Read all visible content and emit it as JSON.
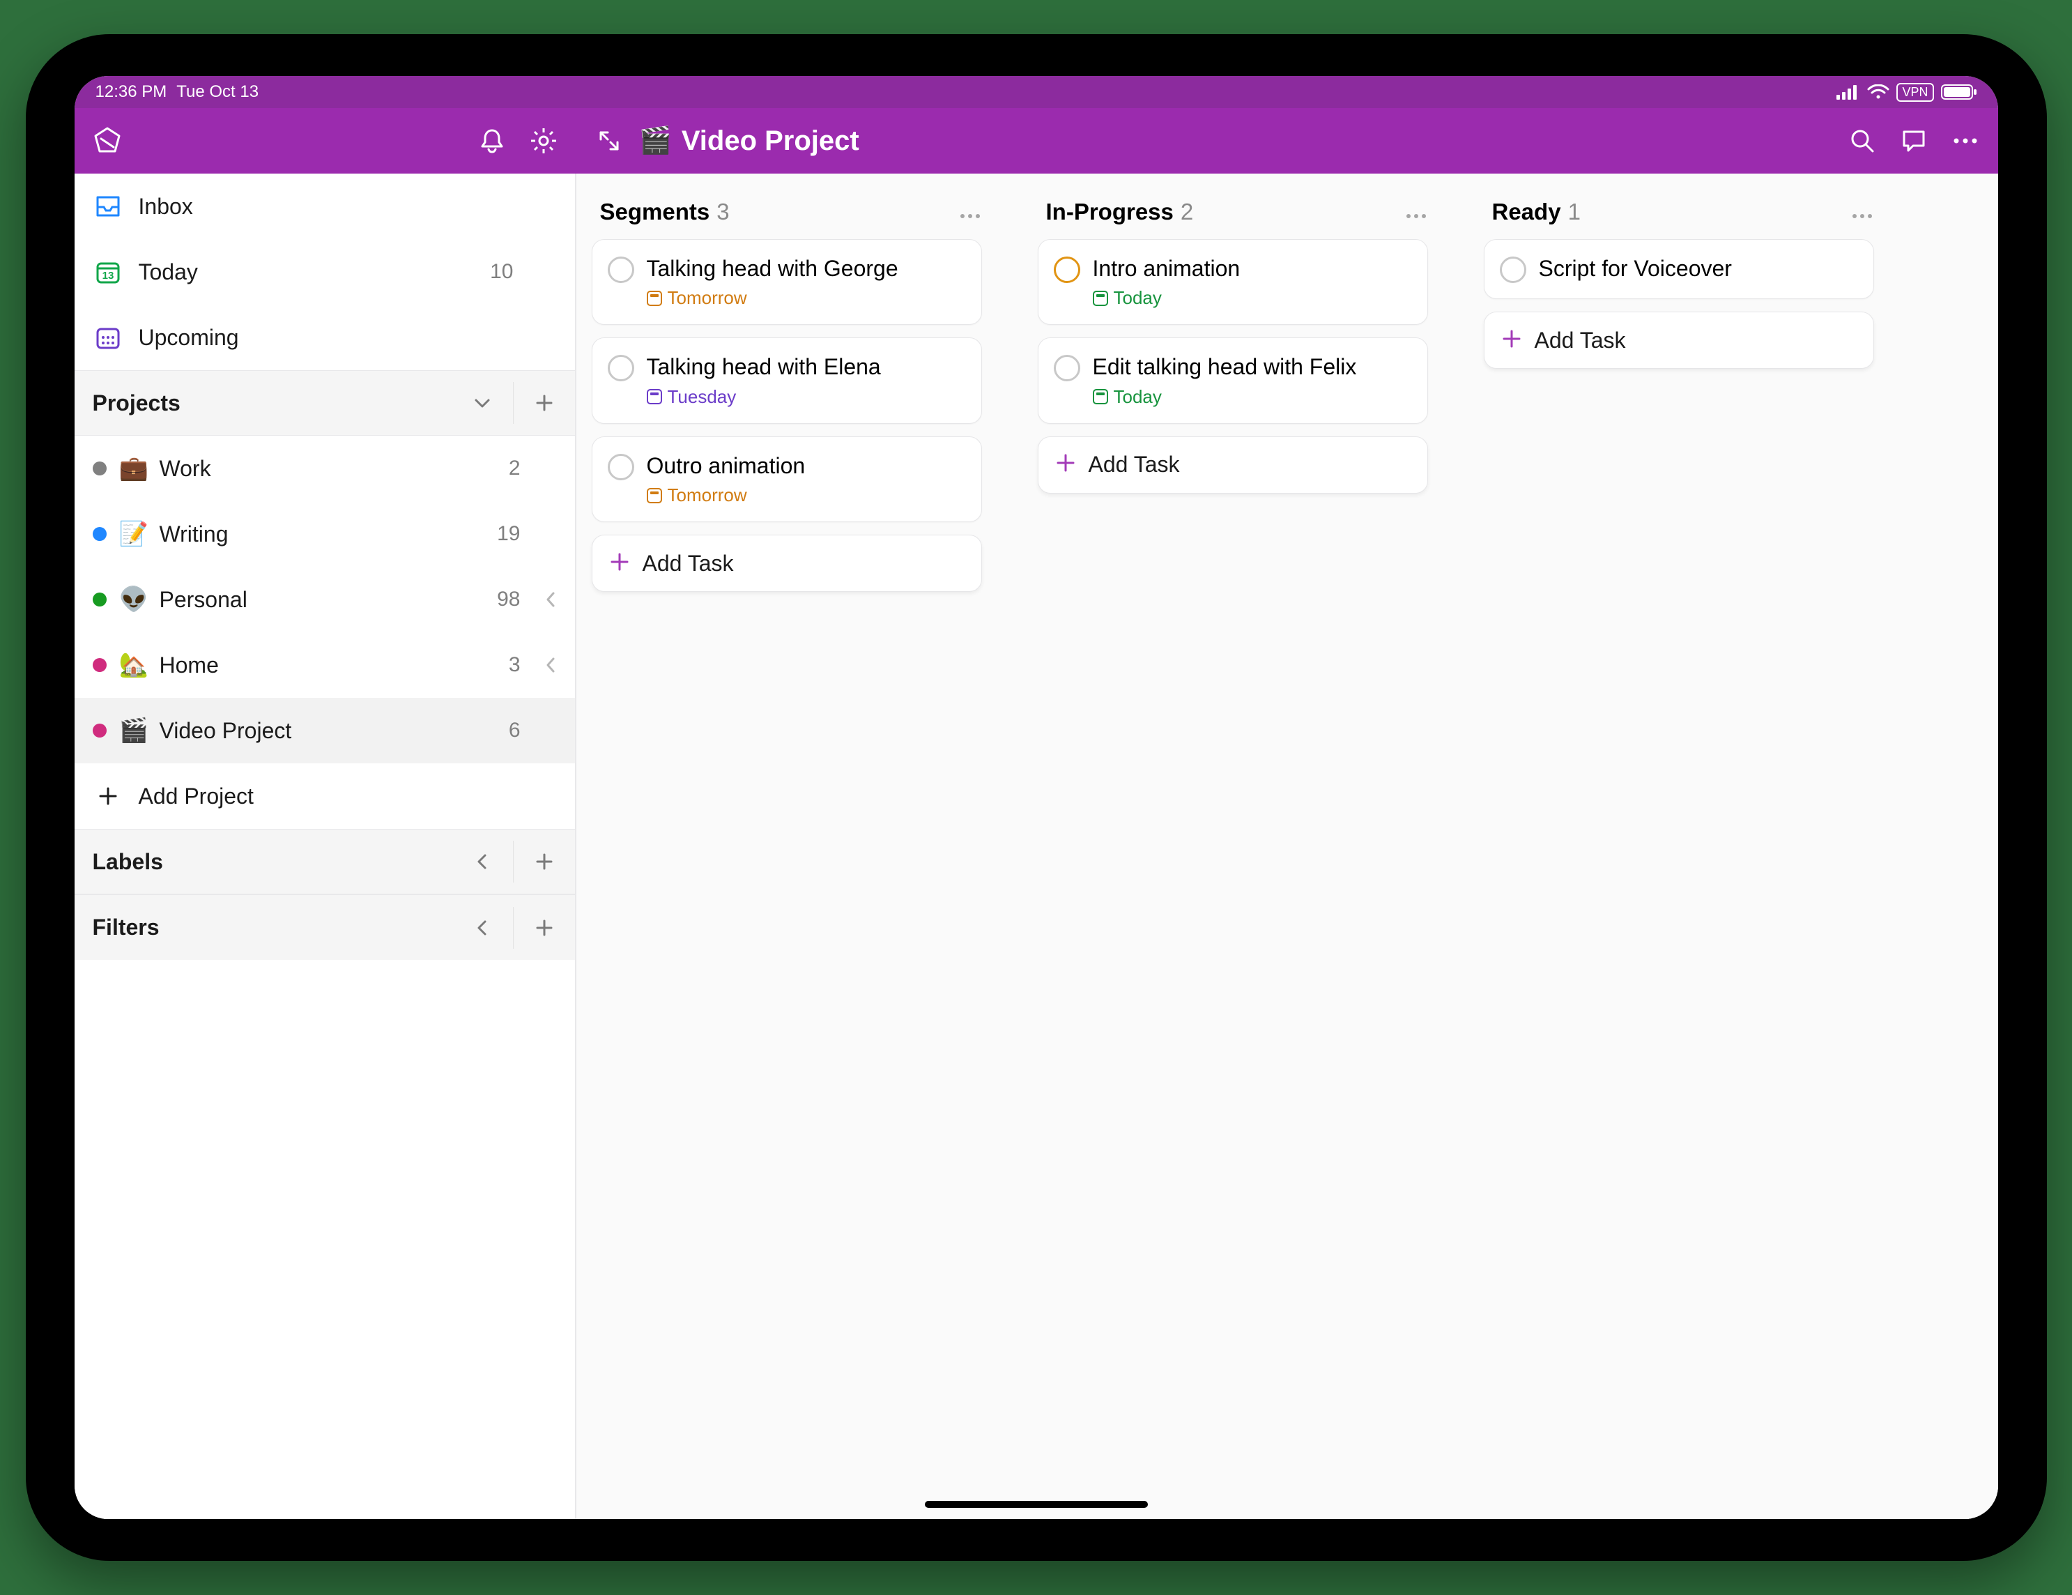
{
  "statusbar": {
    "time": "12:36 PM",
    "date": "Tue Oct 13",
    "vpn": "VPN"
  },
  "header": {
    "project_emoji": "🎬",
    "project_name": "Video Project"
  },
  "sidebar": {
    "inbox_label": "Inbox",
    "today_label": "Today",
    "today_count": "10",
    "upcoming_label": "Upcoming",
    "projects_header": "Projects",
    "add_project_label": "Add Project",
    "labels_header": "Labels",
    "filters_header": "Filters",
    "projects": [
      {
        "dot": "#808080",
        "emoji": "💼",
        "name": "Work",
        "count": "2",
        "expandable": false
      },
      {
        "dot": "#1f87ff",
        "emoji": "📝",
        "name": "Writing",
        "count": "19",
        "expandable": false
      },
      {
        "dot": "#179b21",
        "emoji": "👽",
        "name": "Personal",
        "count": "98",
        "expandable": true
      },
      {
        "dot": "#d02c7e",
        "emoji": "🏡",
        "name": "Home",
        "count": "3",
        "expandable": true
      },
      {
        "dot": "#d02c7e",
        "emoji": "🎬",
        "name": "Video Project",
        "count": "6",
        "expandable": false,
        "selected": true
      }
    ]
  },
  "board": {
    "add_task_label": "Add Task",
    "columns": [
      {
        "title": "Segments",
        "count": "3",
        "cards": [
          {
            "title": "Talking head with George",
            "meta_text": "Tomorrow",
            "meta_kind": "tomorrow",
            "priority": false
          },
          {
            "title": "Talking head with Elena",
            "meta_text": "Tuesday",
            "meta_kind": "tuesday",
            "priority": false
          },
          {
            "title": "Outro animation",
            "meta_text": "Tomorrow",
            "meta_kind": "tomorrow",
            "priority": false
          }
        ]
      },
      {
        "title": "In-Progress",
        "count": "2",
        "cards": [
          {
            "title": "Intro animation",
            "meta_text": "Today",
            "meta_kind": "today",
            "priority": true
          },
          {
            "title": "Edit talking head with Felix",
            "meta_text": "Today",
            "meta_kind": "today",
            "priority": false
          }
        ]
      },
      {
        "title": "Ready",
        "count": "1",
        "cards": [
          {
            "title": "Script for Voiceover",
            "meta_text": "",
            "meta_kind": "",
            "priority": false
          }
        ]
      }
    ]
  }
}
